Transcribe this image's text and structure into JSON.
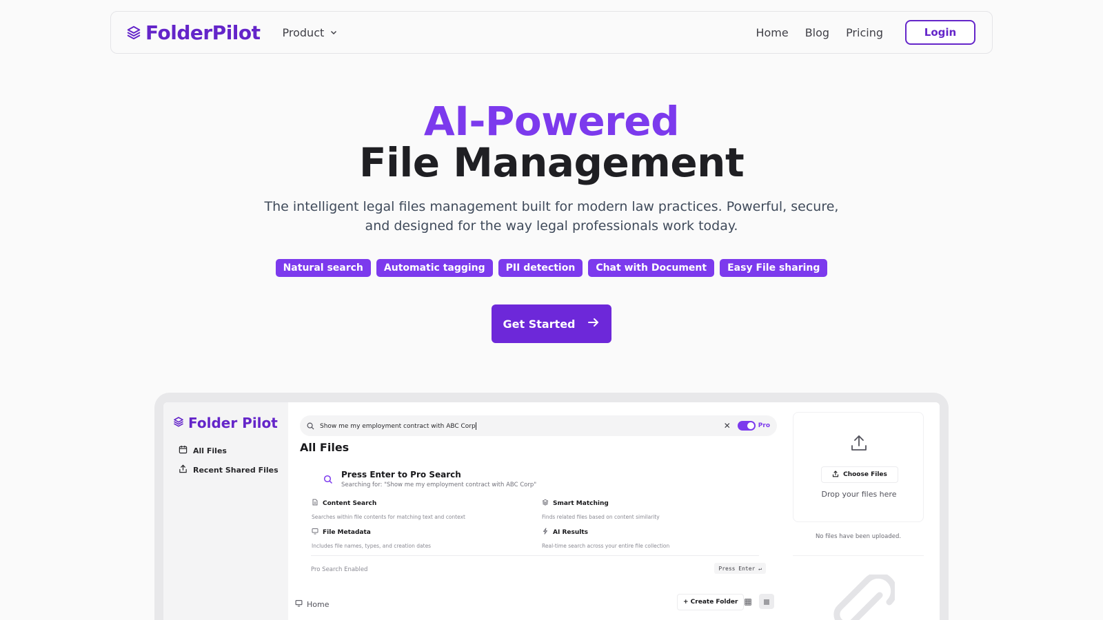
{
  "nav": {
    "brand": "FolderPilot",
    "product_label": "Product",
    "links": [
      "Home",
      "Blog",
      "Pricing"
    ],
    "login_label": "Login"
  },
  "hero": {
    "title_accent": "AI-Powered",
    "title_main": "File Management",
    "subtitle": "The intelligent legal files management built for modern law practices. Powerful, secure, and designed for the way legal professionals work today.",
    "tags": [
      "Natural search",
      "Automatic tagging",
      "PII detection",
      "Chat with Document",
      "Easy File sharing"
    ],
    "cta_label": "Get Started"
  },
  "app": {
    "brand": "Folder Pilot",
    "sidebar": {
      "all_files": "All Files",
      "recent_shared": "Recent Shared Files"
    },
    "search": {
      "value": "Show me my employment contract with ABC Corp",
      "pro_label": "Pro"
    },
    "main_title": "All Files",
    "pro_search": {
      "title": "Press Enter to Pro Search",
      "searching_for": "Searching for: \"Show me my employment contract with ABC Corp\"",
      "features": [
        {
          "title": "Content Search",
          "desc": "Searches within file contents for matching text and context"
        },
        {
          "title": "Smart Matching",
          "desc": "Finds related files based on content similarity"
        },
        {
          "title": "File Metadata",
          "desc": "Includes file names, types, and creation dates"
        },
        {
          "title": "AI Results",
          "desc": "Real-time search across your entire file collection"
        }
      ],
      "footer_label": "Pro Search Enabled",
      "press_enter": "Press Enter ↵"
    },
    "breadcrumb": "Home",
    "create_folder": "+ Create Folder",
    "upload": {
      "choose_files": "Choose Files",
      "drop_text": "Drop your files here",
      "no_files": "No files have been uploaded."
    }
  },
  "colors": {
    "brand": "#6425c9",
    "accent": "#7c3aed",
    "cta": "#6d28d9"
  }
}
